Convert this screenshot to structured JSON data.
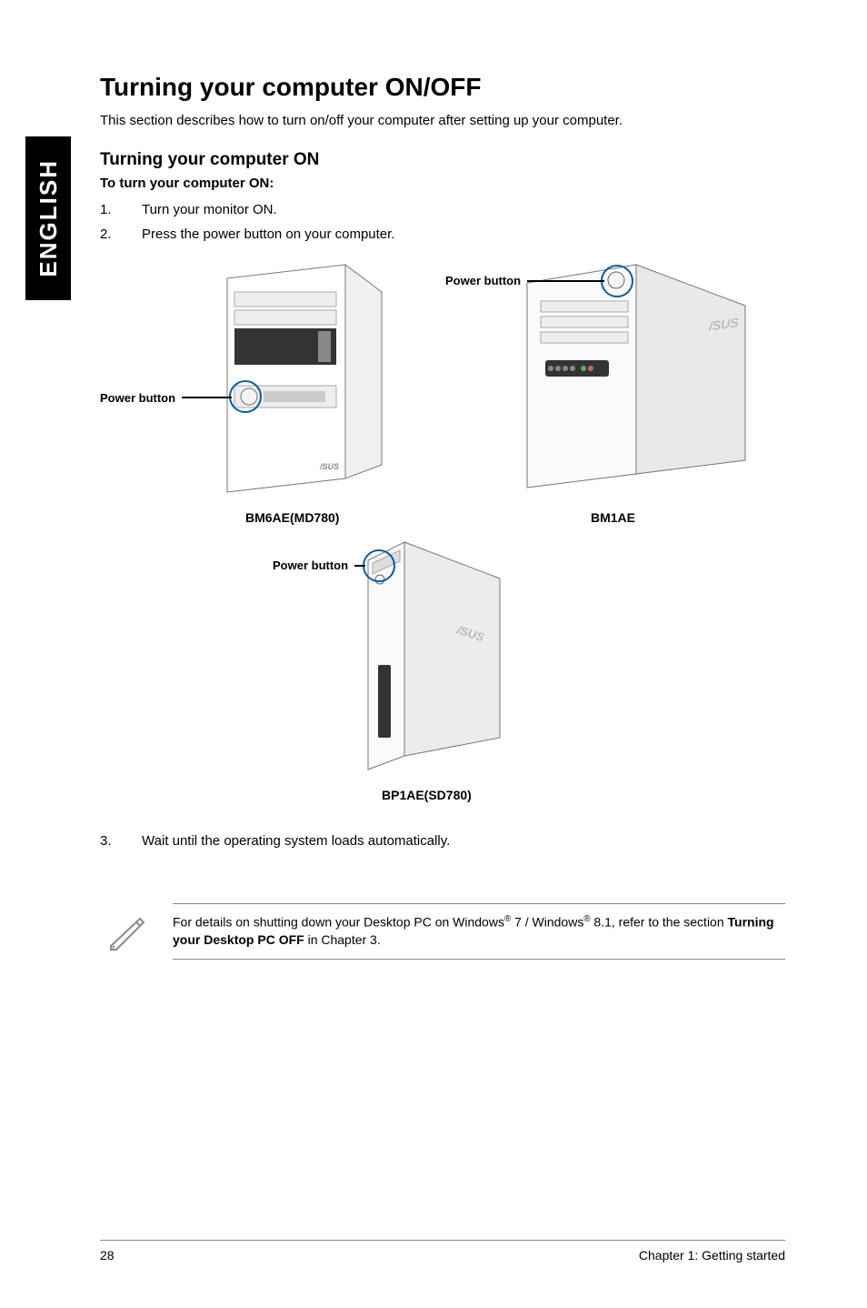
{
  "sideTab": "ENGLISH",
  "title": "Turning your computer ON/OFF",
  "intro": "This section describes how to turn on/off your computer after setting up your computer.",
  "section": "Turning your computer ON",
  "sub": "To turn your computer ON:",
  "steps": {
    "s1": {
      "num": "1.",
      "text": "Turn your monitor ON."
    },
    "s2": {
      "num": "2.",
      "text": "Press the power button on your computer."
    }
  },
  "labels": {
    "powerButton": "Power button"
  },
  "models": {
    "bm6ae": "BM6AE(MD780)",
    "bm1ae": "BM1AE",
    "bp1ae": "BP1AE(SD780)"
  },
  "step3": {
    "num": "3.",
    "text": "Wait until the operating system loads automatically."
  },
  "note": {
    "prefix": "For details on shutting down your Desktop PC on Windows",
    "reg": "®",
    "mid1": " 7 / Windows",
    "mid2": " 8.1, refer to the section ",
    "bold": "Turning your Desktop PC OFF",
    "suffix": " in Chapter 3."
  },
  "footer": {
    "page": "28",
    "chapter": "Chapter 1: Getting started"
  }
}
